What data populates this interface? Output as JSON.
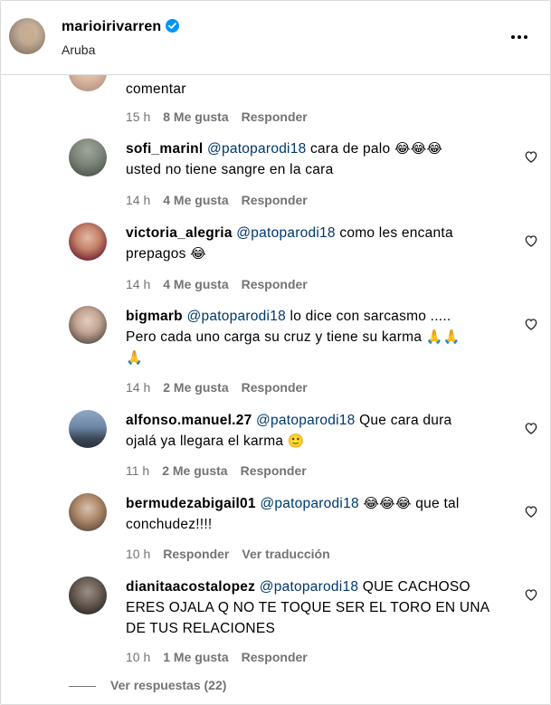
{
  "header": {
    "username": "marioirivarren",
    "location": "Aruba",
    "verified_icon": "verified-badge-icon",
    "more_icon": "more-options-icon"
  },
  "colors": {
    "mention": "#00376b",
    "meta": "#737373",
    "verified": "#0095f6",
    "divider": "#dbdbdb"
  },
  "comments": [
    {
      "text": "comentar",
      "time": "15 h",
      "likes": "8 Me gusta",
      "reply": "Responder"
    },
    {
      "user": "sofi_marinl",
      "mention": "@patoparodi18",
      "text1": " cara de palo ",
      "emoji": "😂😂😂",
      "text2": "usted no tiene sangre en la cara",
      "time": "14 h",
      "likes": "4 Me gusta",
      "reply": "Responder"
    },
    {
      "user": "victoria_alegria",
      "mention": "@patoparodi18",
      "text1": " como les encanta",
      "text2": "prepagos ",
      "emoji": "😂",
      "time": "14 h",
      "likes": "4 Me gusta",
      "reply": "Responder"
    },
    {
      "user": "bigmarb",
      "mention": "@patoparodi18",
      "text1": " lo dice con sarcasmo .....",
      "text2": "Pero cada uno carga su cruz y tiene su karma ",
      "emoji": "🙏🙏",
      "emoji2": "🙏",
      "time": "14 h",
      "likes": "2 Me gusta",
      "reply": "Responder"
    },
    {
      "user": "alfonso.manuel.27",
      "mention": "@patoparodi18",
      "text1": " Que cara dura",
      "text2": "ojalá ya llegara el karma ",
      "emoji": "🙂",
      "time": "11 h",
      "likes": "2 Me gusta",
      "reply": "Responder"
    },
    {
      "user": "bermudezabigail01",
      "mention": "@patoparodi18",
      "emoji": "😂😂😂",
      "text1": " que tal",
      "text2": "conchudez!!!!",
      "time": "10 h",
      "reply": "Responder",
      "translate": "Ver traducción"
    },
    {
      "user": "dianitaacostalopez",
      "mention": "@patoparodi18",
      "text1": " QUE CACHOSO",
      "text2": "ERES OJALA Q NO TE TOQUE SER EL TORO EN UNA",
      "text3": "DE TUS RELACIONES",
      "time": "10 h",
      "likes": "1 Me gusta",
      "reply": "Responder"
    }
  ],
  "view_replies": "Ver respuestas (22)"
}
